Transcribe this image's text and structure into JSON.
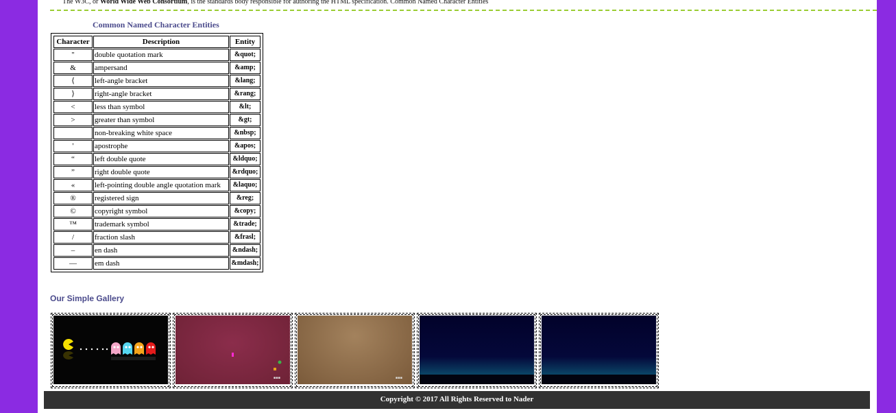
{
  "intro": {
    "prefix": "The W3C, or ",
    "bold": "World Wide Web Consortium",
    "suffix": ", is the standards body responsible for authoring the HTML specification. Common Named Character Entities"
  },
  "table": {
    "title": "Common Named Character Entities",
    "headers": [
      "Character",
      "Description",
      "Entity"
    ],
    "rows": [
      {
        "char": "\"",
        "desc": "double quotation mark",
        "entity": "&quot;"
      },
      {
        "char": "&",
        "desc": "ampersand",
        "entity": "&amp;"
      },
      {
        "char": "⟨",
        "desc": "left-angle bracket",
        "entity": "&lang;"
      },
      {
        "char": "⟩",
        "desc": "right-angle bracket",
        "entity": "&rang;"
      },
      {
        "char": "<",
        "desc": "less than symbol",
        "entity": "&lt;"
      },
      {
        "char": ">",
        "desc": "greater than symbol",
        "entity": "&gt;"
      },
      {
        "char": "",
        "desc": "non-breaking white space",
        "entity": "&nbsp;"
      },
      {
        "char": "'",
        "desc": "apostrophe",
        "entity": "&apos;"
      },
      {
        "char": "“",
        "desc": "left double quote",
        "entity": "&ldquo;"
      },
      {
        "char": "”",
        "desc": "right double quote",
        "entity": "&rdquo;"
      },
      {
        "char": "«",
        "desc": "left-pointing double angle quotation mark",
        "entity": "&laquo;"
      },
      {
        "char": "®",
        "desc": "registered sign",
        "entity": "&reg;"
      },
      {
        "char": "©",
        "desc": "copyright symbol",
        "entity": "&copy;"
      },
      {
        "char": "™",
        "desc": "trademark symbol",
        "entity": "&trade;"
      },
      {
        "char": "/",
        "desc": "fraction slash",
        "entity": "&frasl;"
      },
      {
        "char": "–",
        "desc": "en dash",
        "entity": "&ndash;"
      },
      {
        "char": "—",
        "desc": "em dash",
        "entity": "&mdash;"
      }
    ]
  },
  "gallery": {
    "title": "Our Simple Gallery",
    "images": [
      {
        "name": "pacman-image"
      },
      {
        "name": "red-landscape-image"
      },
      {
        "name": "brown-landscape-image"
      },
      {
        "name": "night-sky-image"
      },
      {
        "name": "night-sky-image-2"
      }
    ]
  },
  "footer": {
    "text": "Copyright © 2017 All Rights Reserved to Nader"
  },
  "colors": {
    "background": "#8b2be2",
    "heading": "#4b4b8c",
    "rule": "#9acd32",
    "footer": "#323232"
  }
}
